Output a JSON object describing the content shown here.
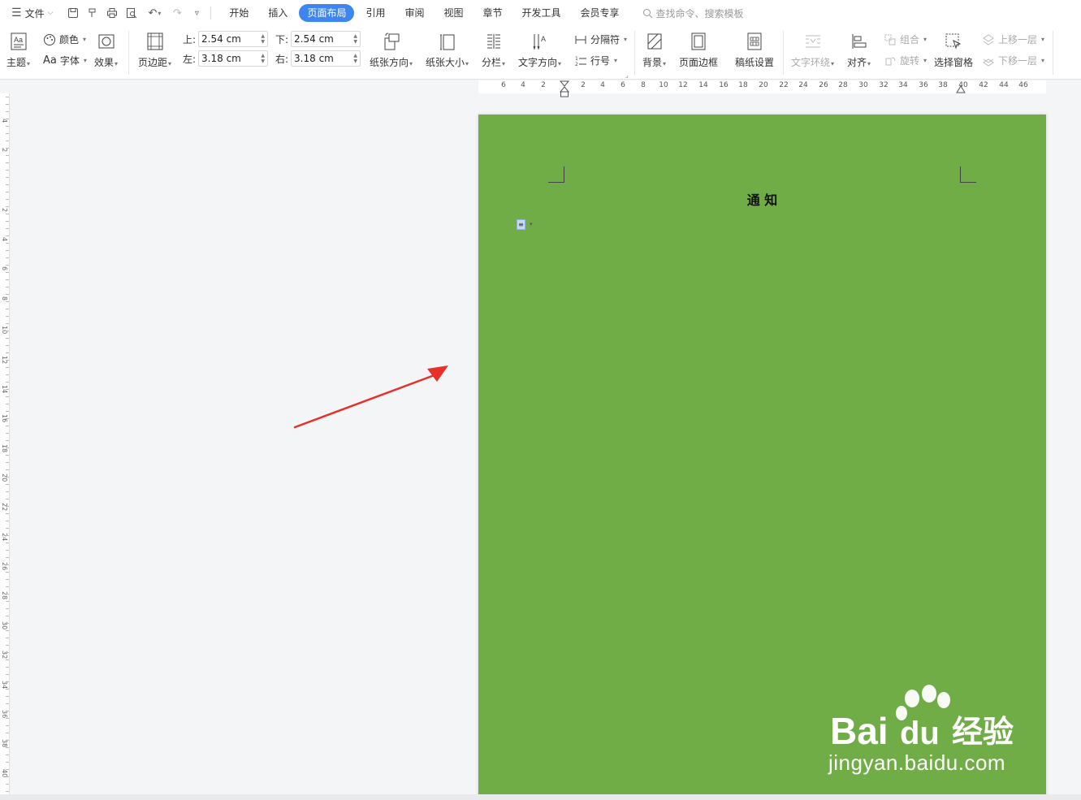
{
  "menubar": {
    "file_label": "文件",
    "tabs": [
      "开始",
      "插入",
      "页面布局",
      "引用",
      "审阅",
      "视图",
      "章节",
      "开发工具",
      "会员专享"
    ],
    "active_tab": "页面布局",
    "search_placeholder": "查找命令、搜索模板"
  },
  "ribbon": {
    "theme": "主题",
    "color": "颜色",
    "font": "字体",
    "font_prefix": "Aa",
    "effect": "效果",
    "margins": "页边距",
    "margin_top_label": "上:",
    "margin_top_value": "2.54 cm",
    "margin_bottom_label": "下:",
    "margin_bottom_value": "2.54 cm",
    "margin_left_label": "左:",
    "margin_left_value": "3.18 cm",
    "margin_right_label": "右:",
    "margin_right_value": "3.18 cm",
    "orientation": "纸张方向",
    "paper_size": "纸张大小",
    "columns": "分栏",
    "text_direction": "文字方向",
    "separator": "分隔符",
    "line_numbers": "行号",
    "background": "背景",
    "page_border": "页面边框",
    "manuscript": "稿纸设置",
    "text_wrap": "文字环绕",
    "align": "对齐",
    "group": "组合",
    "rotate": "旋转",
    "selection_pane": "选择窗格",
    "bring_forward": "上移一层",
    "send_backward": "下移一层"
  },
  "ruler": {
    "h_ticks": [
      "6",
      "4",
      "2",
      "2",
      "4",
      "6",
      "8",
      "10",
      "12",
      "14",
      "16",
      "18",
      "20",
      "22",
      "24",
      "26",
      "28",
      "30",
      "32",
      "34",
      "36",
      "38",
      "40",
      "42",
      "44",
      "46"
    ],
    "v_ticks": [
      "4",
      "2",
      "2",
      "4",
      "6",
      "8",
      "10",
      "12",
      "14",
      "16",
      "18",
      "20",
      "22",
      "24",
      "26",
      "28",
      "30",
      "32",
      "34",
      "36",
      "38",
      "40"
    ]
  },
  "document": {
    "title": "通 知",
    "page_color": "#70ad47"
  },
  "annotation": {
    "arrow_color": "#e8302a"
  },
  "watermark": {
    "logo_text": "Bai",
    "logo_text2": "du",
    "logo_cn": "经验",
    "url": "jingyan.baidu.com"
  },
  "colors": {
    "accent": "#3d86f0"
  }
}
